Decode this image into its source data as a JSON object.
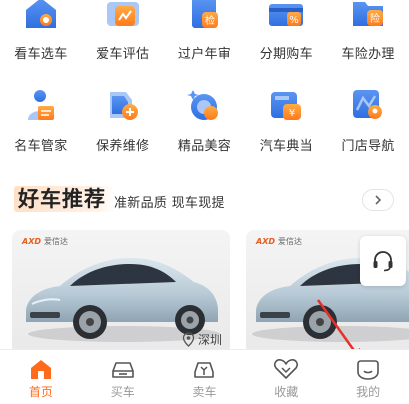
{
  "services_row1": [
    {
      "label": "看车选车",
      "icon": "house-search-icon"
    },
    {
      "label": "爱车评估",
      "icon": "car-evaluate-icon"
    },
    {
      "label": "过户年审",
      "icon": "inspection-document-icon"
    },
    {
      "label": "分期购车",
      "icon": "installment-card-icon"
    },
    {
      "label": "车险办理",
      "icon": "insurance-folder-icon"
    }
  ],
  "services_row2": [
    {
      "label": "名车管家",
      "icon": "butler-icon"
    },
    {
      "label": "保养维修",
      "icon": "maintenance-icon"
    },
    {
      "label": "精品美容",
      "icon": "car-beauty-icon"
    },
    {
      "label": "汽车典当",
      "icon": "pawn-icon"
    },
    {
      "label": "门店导航",
      "icon": "store-navigation-icon"
    }
  ],
  "recommend": {
    "title": "好车推荐",
    "subtitle": "准新品质 现车现提"
  },
  "cards": [
    {
      "brand": "AXD",
      "brand_text": "爱信达",
      "location": "深圳"
    },
    {
      "brand": "AXD",
      "brand_text": "爱信达",
      "location": ""
    }
  ],
  "tabbar": [
    {
      "label": "首页",
      "icon": "home-icon",
      "active": true
    },
    {
      "label": "买车",
      "icon": "buy-car-icon",
      "active": false
    },
    {
      "label": "卖车",
      "icon": "sell-car-icon",
      "active": false
    },
    {
      "label": "收藏",
      "icon": "favorite-heart-icon",
      "active": false
    },
    {
      "label": "我的",
      "icon": "profile-icon",
      "active": false
    }
  ],
  "colors": {
    "accent": "#ff6b1a",
    "icon_blue": "#3d7ce8",
    "icon_light": "#a9c8f7",
    "icon_orange": "#ff8a2a"
  }
}
